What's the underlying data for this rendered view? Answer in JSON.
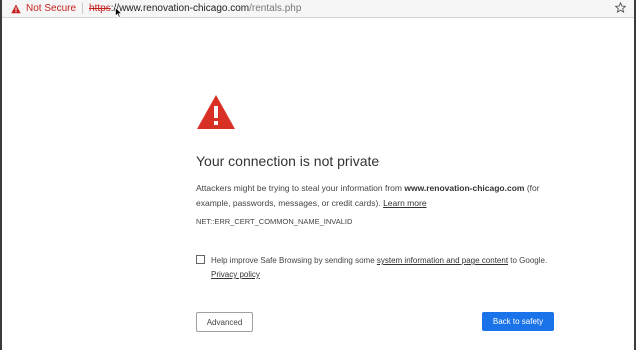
{
  "address_bar": {
    "security_label": "Not Secure",
    "url_scheme": "https",
    "url_separator": "://",
    "url_host": "www.renovation-chicago.com",
    "url_path": "/rentals.php",
    "warning_color": "#c5221f"
  },
  "interstitial": {
    "heading": "Your connection is not private",
    "body_prefix": "Attackers might be trying to steal your information from ",
    "body_domain": "www.renovation-chicago.com",
    "body_suffix": " (for example, passwords, messages, or credit cards). ",
    "learn_more": "Learn more",
    "error_code": "NET::ERR_CERT_COMMON_NAME_INVALID",
    "checkbox_prefix": "Help improve Safe Browsing by sending some ",
    "checkbox_link": "system information and page content",
    "checkbox_suffix": " to Google.",
    "privacy_policy": "Privacy policy",
    "advanced_button": "Advanced",
    "back_button": "Back to safety",
    "accent_color": "#1a73e8",
    "warning_icon_color": "#d93025"
  },
  "icons": {
    "address_warning": "warning-triangle-icon",
    "bookmark": "star-icon",
    "page_warning": "warning-triangle-icon",
    "cursor": "mouse-cursor-icon"
  }
}
